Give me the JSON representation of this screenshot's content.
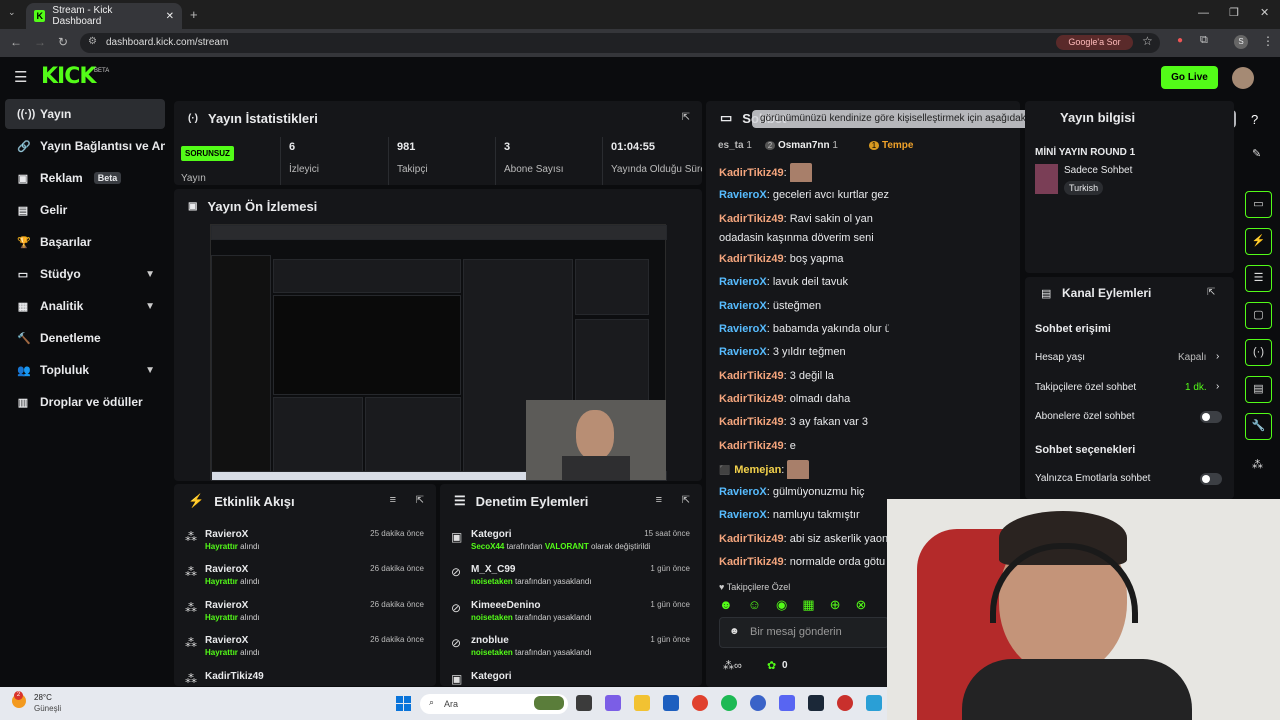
{
  "browser": {
    "tab_title": "Stream - Kick Dashboard",
    "url": "dashboard.kick.com/stream",
    "google_sor": "Google'a Sor",
    "profile_initial": "S"
  },
  "header": {
    "logo": "KICK",
    "logo_beta": "BETA",
    "go_live": "Go Live"
  },
  "sidebar": {
    "items": [
      {
        "label": "Yayın",
        "icon": "broadcast-icon"
      },
      {
        "label": "Yayın Bağlantısı ve Anahtarı",
        "icon": "link-icon"
      },
      {
        "label": "Reklam",
        "icon": "ad-icon",
        "badge": "Beta"
      },
      {
        "label": "Gelir",
        "icon": "revenue-icon"
      },
      {
        "label": "Başarılar",
        "icon": "trophy-icon"
      },
      {
        "label": "Stüdyo",
        "icon": "studio-icon"
      },
      {
        "label": "Analitik",
        "icon": "analytics-icon"
      },
      {
        "label": "Denetleme",
        "icon": "moderation-icon"
      },
      {
        "label": "Topluluk",
        "icon": "community-icon"
      },
      {
        "label": "Droplar ve ödüller",
        "icon": "drops-icon"
      }
    ]
  },
  "stats": {
    "title": "Yayın İstatistikleri",
    "status": "SORUNSUZ",
    "status_label": "Yayın",
    "items": [
      {
        "value": "6",
        "label": "İzleyici"
      },
      {
        "value": "981",
        "label": "Takipçi"
      },
      {
        "value": "3",
        "label": "Abone Sayısı"
      },
      {
        "value": "01:04:55",
        "label": "Yayında Olduğu Süre"
      }
    ]
  },
  "preview": {
    "title": "Yayın Ön İzlemesi"
  },
  "activity": {
    "title": "Etkinlik Akışı",
    "items": [
      {
        "name": "RavieroX",
        "action": "Hayrattır",
        "suffix": "alındı",
        "time": "25 dakika önce"
      },
      {
        "name": "RavieroX",
        "action": "Hayrattır",
        "suffix": "alındı",
        "time": "26 dakika önce"
      },
      {
        "name": "RavieroX",
        "action": "Hayrattır",
        "suffix": "alındı",
        "time": "26 dakika önce"
      },
      {
        "name": "RavieroX",
        "action": "Hayrattır",
        "suffix": "alındı",
        "time": "26 dakika önce"
      },
      {
        "name": "KadirTikiz49",
        "action": "",
        "suffix": "",
        "time": ""
      }
    ]
  },
  "moderation": {
    "title": "Denetim Eylemleri",
    "items": [
      {
        "name": "Kategori",
        "actor": "SecoX44",
        "mid": "tarafından",
        "target": "VALORANT",
        "end": "olarak değiştirildi",
        "time": "15 saat önce"
      },
      {
        "name": "M_X_C99",
        "actor": "noisetaken",
        "mid": "tarafından yasaklandı",
        "target": "",
        "end": "",
        "time": "1 gün önce"
      },
      {
        "name": "KimeeeDenino",
        "actor": "noisetaken",
        "mid": "tarafından yasaklandı",
        "target": "",
        "end": "",
        "time": "1 gün önce"
      },
      {
        "name": "znoblue",
        "actor": "noisetaken",
        "mid": "tarafından yasaklandı",
        "target": "",
        "end": "",
        "time": "1 gün önce"
      },
      {
        "name": "Kategori",
        "actor": "",
        "mid": "",
        "target": "",
        "end": "",
        "time": ""
      }
    ]
  },
  "chat": {
    "title": "Sohbet",
    "tooltip": "görünümünüzü kendinize göre kişiselleştirmek için aşağıdaki eklenti alanlarını sürükleyin veya bırakın",
    "top": {
      "left": "es_ta",
      "left_count": "1",
      "mid_rank": "2",
      "mid": "Osman7nn",
      "mid_count": "1",
      "right_rank": "1",
      "right": "Tempe"
    },
    "messages": [
      {
        "user": "KadirTikiz49",
        "text": "",
        "style": "a",
        "emote": true
      },
      {
        "user": "RavieroX",
        "text": "geceleri avcı kurtlar gezer",
        "style": "b"
      },
      {
        "user": "KadirTikiz49",
        "text": "Ravi sakin ol yan odadasin kaşınma döverim seni",
        "style": "a"
      },
      {
        "user": "KadirTikiz49",
        "text": "boş yapma",
        "style": "a"
      },
      {
        "user": "RavieroX",
        "text": "lavuk deil tavuk",
        "style": "b"
      },
      {
        "user": "RavieroX",
        "text": "üsteğmen",
        "style": "b"
      },
      {
        "user": "RavieroX",
        "text": "babamda yakında olur üsteğmen",
        "style": "b"
      },
      {
        "user": "RavieroX",
        "text": "3 yıldır teğmen",
        "style": "b"
      },
      {
        "user": "KadirTikiz49",
        "text": "3 değil la",
        "style": "a"
      },
      {
        "user": "KadirTikiz49",
        "text": "olmadı daha",
        "style": "a"
      },
      {
        "user": "KadirTikiz49",
        "text": "3 ay fakan var 3",
        "style": "a"
      },
      {
        "user": "KadirTikiz49",
        "text": "e",
        "style": "a"
      },
      {
        "user": "Memejan",
        "text": "",
        "style": "c",
        "emote": true
      },
      {
        "user": "RavieroX",
        "text": "gülmüyonuzmu hiç",
        "style": "b"
      },
      {
        "user": "RavieroX",
        "text": "namluyu takmıştır",
        "style": "b"
      },
      {
        "user": "KadirTikiz49",
        "text": "abi siz askerlik yaon",
        "style": "a"
      },
      {
        "user": "KadirTikiz49",
        "text": "normalde orda götu",
        "style": "a"
      }
    ],
    "followers_only": "Takipçilere Özel",
    "input_placeholder": "Bir mesaj gönderin",
    "footer_count": "0"
  },
  "info": {
    "title": "Yayın bilgisi",
    "stream_title": "MİNİ YAYIN ROUND 1",
    "category": "Sadece Sohbet",
    "language": "Turkish"
  },
  "channel_actions": {
    "title": "Kanal Eylemleri",
    "chat_access": "Sohbet erişimi",
    "account_age": "Hesap yaşı",
    "account_age_value": "Kapalı",
    "followers_chat": "Takipçilere özel sohbet",
    "followers_chat_value": "1 dk.",
    "subs_chat": "Abonelere özel sohbet",
    "chat_options": "Sohbet seçenekleri",
    "emote_only": "Yalnızca Emotlarla sohbet"
  },
  "taskbar": {
    "temp": "28°C",
    "weather": "Güneşli",
    "search": "Ara",
    "notif": "2"
  },
  "colors": {
    "accent": "#53fc18",
    "panel": "#151619",
    "bg": "#0b0c0e"
  }
}
